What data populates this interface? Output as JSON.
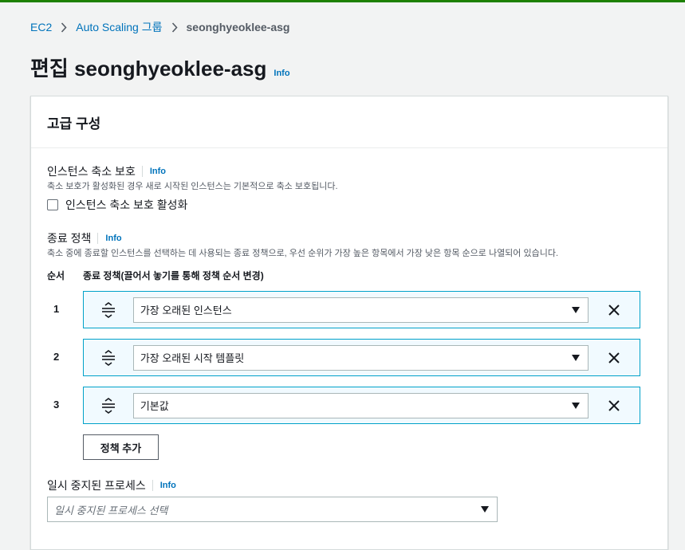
{
  "breadcrumb": {
    "items": [
      "EC2",
      "Auto Scaling 그룹"
    ],
    "current": "seonghyeoklee-asg"
  },
  "page": {
    "title": "편집 seonghyeoklee-asg",
    "info": "Info"
  },
  "panel": {
    "title": "고급 구성"
  },
  "scale_in_protection": {
    "label": "인스턴스 축소 보호",
    "info": "Info",
    "description": "축소 보호가 활성화된 경우 새로 시작된 인스턴스는 기본적으로 축소 보호됩니다.",
    "checkbox_label": "인스턴스 축소 보호 활성화",
    "checked": false
  },
  "termination_policy": {
    "label": "종료 정책",
    "info": "Info",
    "description": "축소 중에 종료할 인스턴스를 선택하는 데 사용되는 종료 정책으로, 우선 순위가 가장 높은 항목에서 가장 낮은 항목 순으로 나열되어 있습니다.",
    "col_order": "순서",
    "col_policy": "종료 정책(끌어서 놓기를 통해 정책 순서 변경)",
    "rows": [
      {
        "order": "1",
        "value": "가장 오래된 인스턴스"
      },
      {
        "order": "2",
        "value": "가장 오래된 시작 템플릿"
      },
      {
        "order": "3",
        "value": "기본값"
      }
    ],
    "add_button": "정책 추가"
  },
  "suspended_processes": {
    "label": "일시 중지된 프로세스",
    "info": "Info",
    "placeholder": "일시 중지된 프로세스 선택"
  },
  "colors": {
    "link": "#0073bb",
    "row_bg": "#f1faff",
    "row_border": "#00a1c9",
    "top_bar": "#1d8102"
  }
}
